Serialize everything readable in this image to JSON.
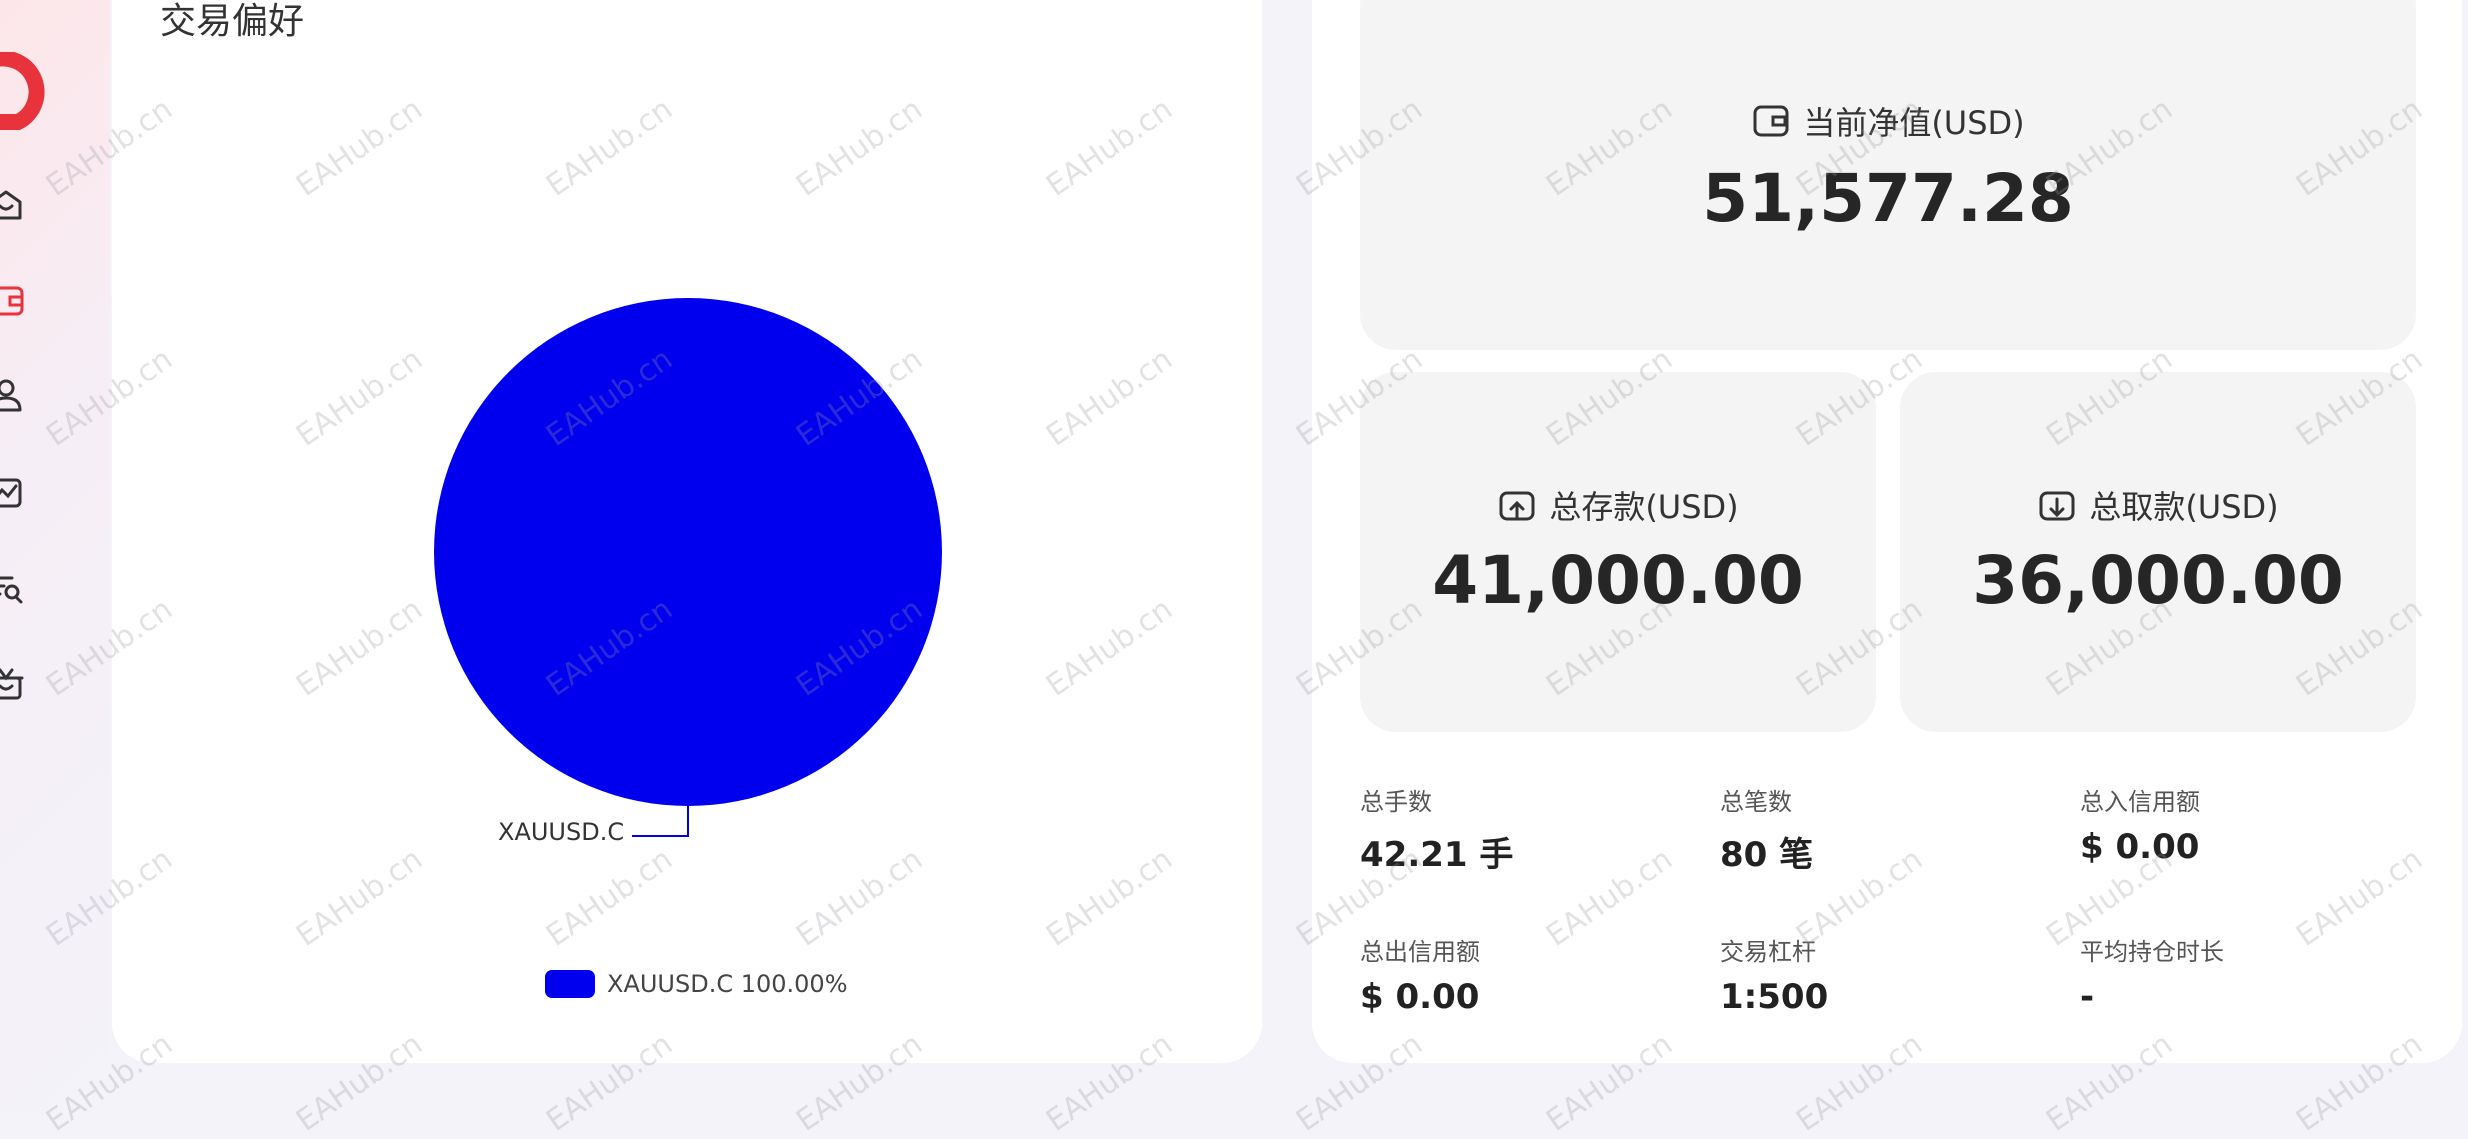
{
  "sidebar": {
    "icons": [
      "home-icon",
      "wallet-icon",
      "user-icon",
      "chart-icon",
      "search-user-icon",
      "gift-icon"
    ],
    "active_color": "#e8323c"
  },
  "trading_preference": {
    "title": "交易偏好",
    "pie_color": "#0000ee",
    "pie_slice_label": "XAUUSD.C",
    "legend": "XAUUSD.C 100.00%"
  },
  "chart_data": {
    "type": "pie",
    "categories": [
      "XAUUSD.C"
    ],
    "values": [
      100.0
    ],
    "title": "交易偏好",
    "legend": [
      "XAUUSD.C 100.00%"
    ]
  },
  "net_value": {
    "label": "当前净值(USD)",
    "value": "51,577.28"
  },
  "total_deposit": {
    "label": "总存款(USD)",
    "value": "41,000.00"
  },
  "total_withdrawal": {
    "label": "总取款(USD)",
    "value": "36,000.00"
  },
  "metrics": [
    {
      "label": "总手数",
      "value": "42.21 手"
    },
    {
      "label": "总笔数",
      "value": "80 笔"
    },
    {
      "label": "总入信用额",
      "value": "$ 0.00"
    },
    {
      "label": "总出信用额",
      "value": "$ 0.00"
    },
    {
      "label": "交易杠杆",
      "value": "1:500"
    },
    {
      "label": "平均持仓时长",
      "value": "-"
    }
  ],
  "watermark": "EAHub.cn"
}
